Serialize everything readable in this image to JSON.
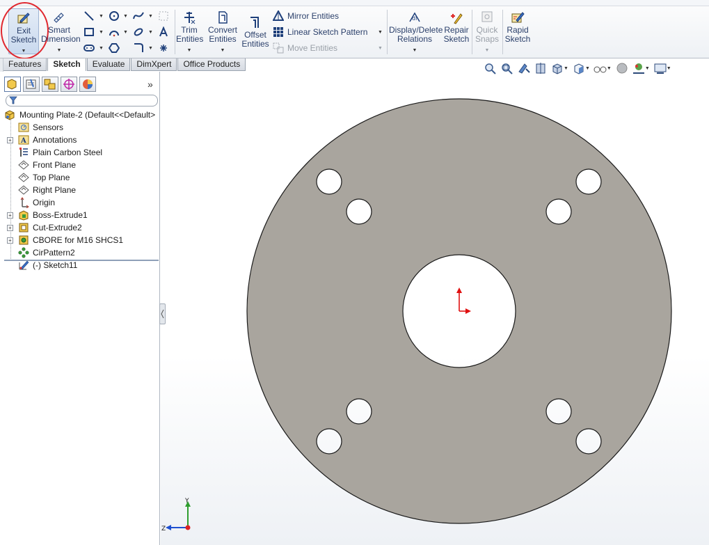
{
  "ribbon": {
    "exit_sketch": "Exit\nSketch",
    "exit_sketch_line1": "Exit",
    "exit_sketch_line2": "Sketch",
    "smart_dimension_line1": "Smart",
    "smart_dimension_line2": "Dimension",
    "trim_line1": "Trim",
    "trim_line2": "Entities",
    "convert_line1": "Convert",
    "convert_line2": "Entities",
    "offset_line1": "Offset",
    "offset_line2": "Entities",
    "mirror_entities": "Mirror Entities",
    "linear_sketch_pattern": "Linear Sketch Pattern",
    "move_entities": "Move Entities",
    "display_delete_line1": "Display/Delete",
    "display_delete_line2": "Relations",
    "repair_line1": "Repair",
    "repair_line2": "Sketch",
    "quick_snaps_line1": "Quick",
    "quick_snaps_line2": "Snaps",
    "rapid_sketch_line1": "Rapid",
    "rapid_sketch_line2": "Sketch"
  },
  "tabs": [
    "Features",
    "Sketch",
    "Evaluate",
    "DimXpert",
    "Office Products"
  ],
  "active_tab": "Sketch",
  "feature_tree": {
    "root": "Mounting Plate-2  (Default<<Default>",
    "items": [
      {
        "label": "Sensors",
        "icon": "sensors-icon",
        "expandable": false
      },
      {
        "label": "Annotations",
        "icon": "annotations-icon",
        "expandable": true
      },
      {
        "label": "Plain Carbon Steel",
        "icon": "material-icon",
        "expandable": false
      },
      {
        "label": "Front Plane",
        "icon": "plane-icon",
        "expandable": false
      },
      {
        "label": "Top Plane",
        "icon": "plane-icon",
        "expandable": false
      },
      {
        "label": "Right Plane",
        "icon": "plane-icon",
        "expandable": false
      },
      {
        "label": "Origin",
        "icon": "origin-icon",
        "expandable": false
      },
      {
        "label": "Boss-Extrude1",
        "icon": "boss-extrude-icon",
        "expandable": true
      },
      {
        "label": "Cut-Extrude2",
        "icon": "cut-extrude-icon",
        "expandable": true
      },
      {
        "label": "CBORE for M16 SHCS1",
        "icon": "hole-wizard-icon",
        "expandable": true
      },
      {
        "label": "CirPattern2",
        "icon": "circular-pattern-icon",
        "expandable": false
      },
      {
        "label": "(-) Sketch11",
        "icon": "sketch-icon",
        "expandable": false
      }
    ]
  },
  "triad": {
    "y_label": "Y",
    "z_label": "Z"
  },
  "colors": {
    "part_face": "#a9a59e",
    "origin_arrow": "#e01010",
    "annotation_circle": "#e0282f"
  }
}
